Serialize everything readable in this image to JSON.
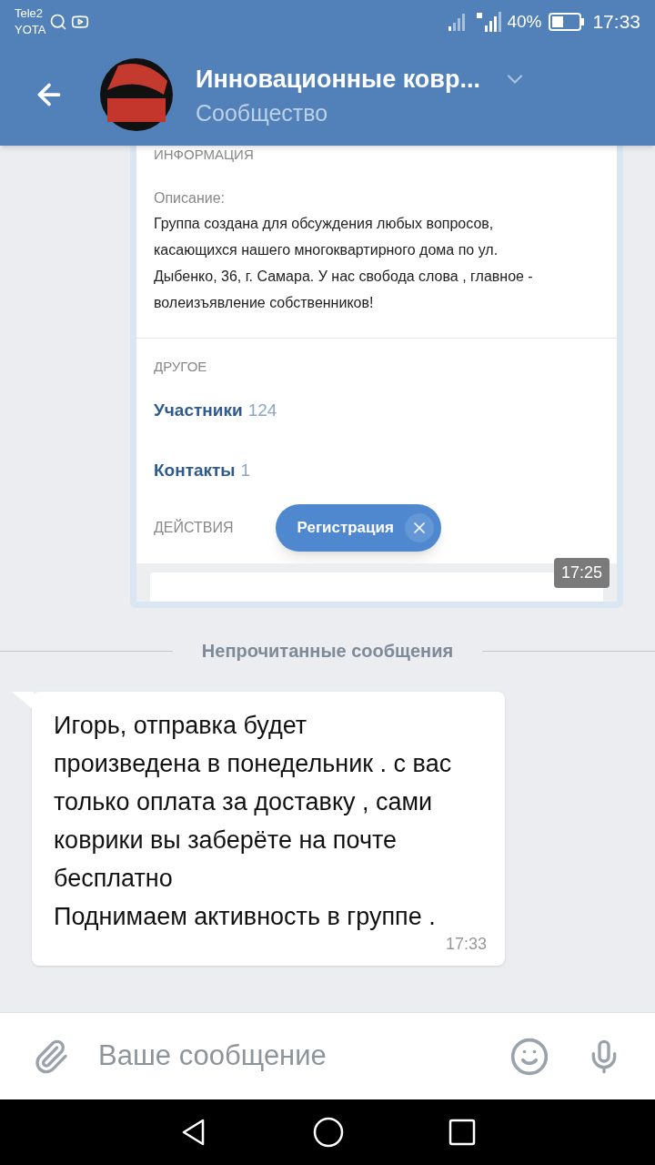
{
  "status_bar": {
    "carriers": [
      "Tele2",
      "YOTA"
    ],
    "battery": "40%",
    "time": "17:33"
  },
  "header": {
    "title": "Инновационные ковр...",
    "subtitle": "Сообщество"
  },
  "shared_screenshot": {
    "section_heading": "ИНФОРМАЦИЯ",
    "description_label": "Описание:",
    "description": "Группа создана для обсуждения любых вопросов, касающихся нашего многоквартирного дома по ул. Дыбенко, 36, г. Самара. У нас свобода слова , главное - волеизъявление собственников!",
    "other_heading": "ДРУГОЕ",
    "links": [
      {
        "label": "Участники",
        "count": "124"
      },
      {
        "label": "Контакты",
        "count": "1"
      }
    ],
    "actions_heading": "ДЕЙСТВИЯ",
    "action_chip": "Регистрация",
    "time": "17:25"
  },
  "unread_divider": "Непрочитанные сообщения",
  "message": {
    "lines": [
      "Игорь, отправка будет произведена в понедельник . с вас только оплата за доставку , сами коврики вы заберёте на почте бесплатно",
      "Поднимаем активность в группе ."
    ],
    "time": "17:33"
  },
  "composer": {
    "placeholder": "Ваше сообщение"
  }
}
